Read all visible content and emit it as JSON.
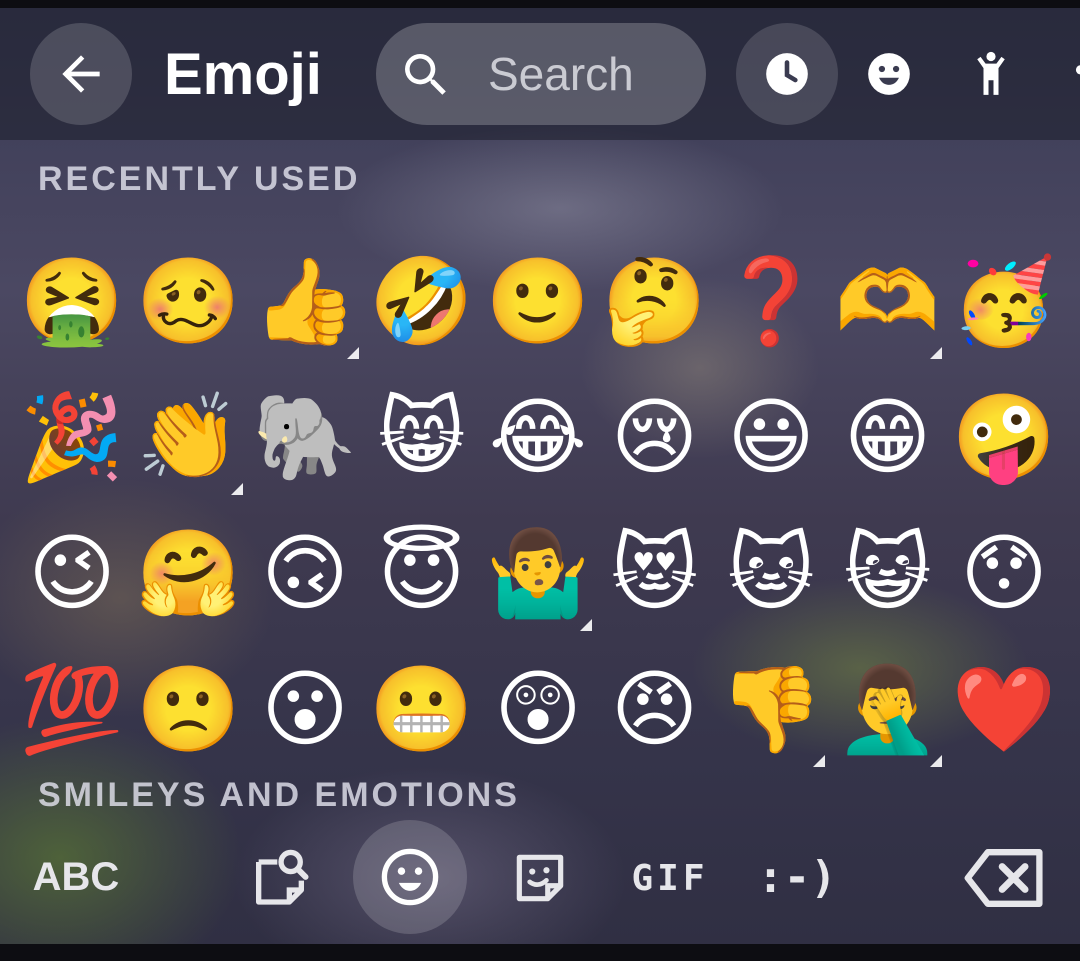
{
  "header": {
    "back_icon": "arrow-left-icon",
    "title": "Emoji",
    "search": {
      "icon": "search-icon",
      "placeholder": "Search"
    },
    "categories": [
      {
        "name": "recent",
        "icon": "clock-icon",
        "active": true
      },
      {
        "name": "smileys",
        "icon": "smiley-face-icon",
        "active": false
      },
      {
        "name": "people",
        "icon": "person-icon",
        "active": false
      },
      {
        "name": "animals",
        "icon": "pawprint-icon",
        "active": false
      }
    ]
  },
  "sections": {
    "recent_title": "RECENTLY USED",
    "smileys_title": "SMILEYS AND EMOTIONS"
  },
  "recent_emojis": [
    {
      "char": "🤮",
      "variants": false
    },
    {
      "char": "🥴",
      "variants": false
    },
    {
      "char": "👍",
      "variants": true
    },
    {
      "char": "🤣",
      "variants": false
    },
    {
      "char": "🙂",
      "variants": false
    },
    {
      "char": "🤔",
      "variants": false
    },
    {
      "char": "❓",
      "variants": false
    },
    {
      "char": "🫶",
      "variants": true
    },
    {
      "char": "🥳",
      "variants": false
    },
    {
      "char": "🎉",
      "variants": false
    },
    {
      "char": "👏",
      "variants": true
    },
    {
      "char": "🐘",
      "variants": false
    },
    {
      "char": "😸",
      "variants": false
    },
    {
      "char": "😂",
      "variants": false
    },
    {
      "char": "😢",
      "variants": false
    },
    {
      "char": "😃",
      "variants": false
    },
    {
      "char": "😁",
      "variants": false
    },
    {
      "char": "🤪",
      "variants": false
    },
    {
      "char": "😉",
      "variants": false
    },
    {
      "char": "🤗",
      "variants": false
    },
    {
      "char": "🙃",
      "variants": false
    },
    {
      "char": "😇",
      "variants": false
    },
    {
      "char": "🤷‍♂️",
      "variants": true
    },
    {
      "char": "😻",
      "variants": false
    },
    {
      "char": "🐱",
      "variants": false
    },
    {
      "char": "😺",
      "variants": false
    },
    {
      "char": "😯",
      "variants": false
    },
    {
      "char": "💯",
      "variants": false
    },
    {
      "char": "🙁",
      "variants": false
    },
    {
      "char": "😮",
      "variants": false
    },
    {
      "char": "😬",
      "variants": false
    },
    {
      "char": "😲",
      "variants": false
    },
    {
      "char": "😠",
      "variants": false
    },
    {
      "char": "👎",
      "variants": true
    },
    {
      "char": "🤦‍♂️",
      "variants": true
    },
    {
      "char": "❤️",
      "variants": false
    }
  ],
  "bottom_bar": {
    "abc_label": "ABC",
    "sticker_search_icon": "sticker-search-icon",
    "emoji_icon": "smiley-face-icon",
    "sticker_icon": "sticker-icon",
    "gif_label": "GIF",
    "emoticon_label": ":-)",
    "delete_icon": "backspace-icon"
  }
}
